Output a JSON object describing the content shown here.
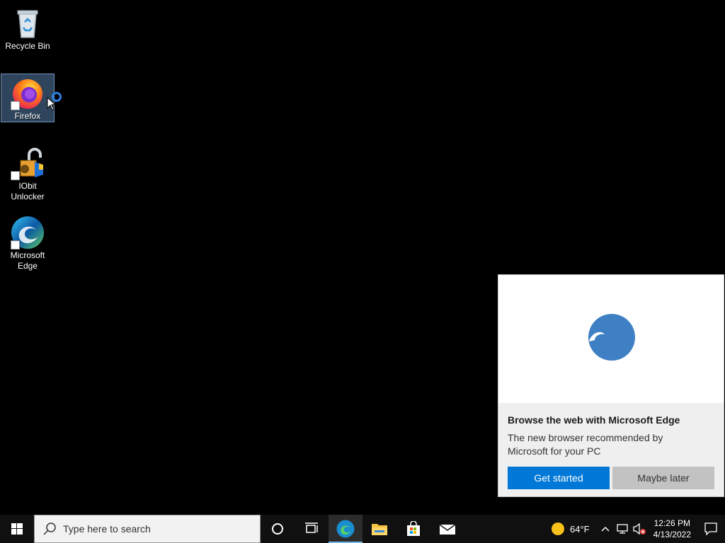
{
  "desktop": {
    "icons": [
      {
        "label": "Recycle Bin"
      },
      {
        "label": "Firefox"
      },
      {
        "label": "IObit Unlocker"
      },
      {
        "label": "Microsoft Edge"
      }
    ]
  },
  "flyout": {
    "title": "Browse the web with Microsoft Edge",
    "description": "The new browser recommended by Microsoft for your PC",
    "primary_label": "Get started",
    "secondary_label": "Maybe later",
    "accent": "#0078d7"
  },
  "taskbar": {
    "search_placeholder": "Type here to search",
    "apps": [
      "edge-icon",
      "file-explorer-icon",
      "store-icon",
      "mail-icon"
    ]
  },
  "tray": {
    "temperature": "64°F",
    "time": "12:26 PM",
    "date": "4/13/2022"
  }
}
